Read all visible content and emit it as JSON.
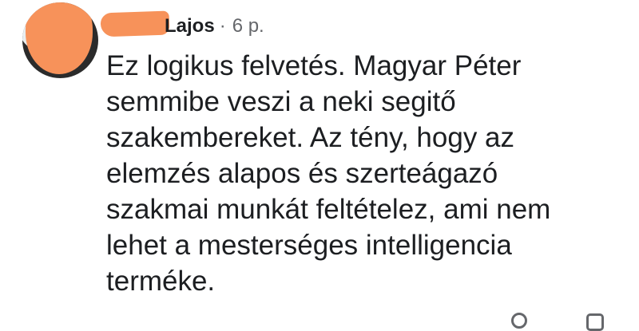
{
  "comment": {
    "author_name": "Lajos",
    "separator": "·",
    "timestamp": "6 p.",
    "text": "Ez logikus felvetés. Magyar Péter\nsemmibe veszi a neki segitő\nszakembereket. Az tény, hogy az\nelemzés alapos és szerteágazó\nszakmai munkát feltételez, ami nem\nlehet a mesterséges intelligencia\nterméke."
  },
  "colors": {
    "redaction": "#f7925a",
    "text": "#1c1e21",
    "secondary_text": "#65676b"
  },
  "icons": {
    "avatar": "profile-photo"
  }
}
